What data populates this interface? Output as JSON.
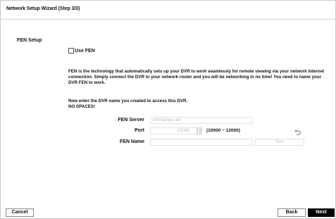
{
  "wizard": {
    "title": "Network Setup Wizard (Step 3/3)"
  },
  "fen_setup": {
    "section_label": "FEN Setup",
    "use_fen": {
      "label": "Use FEN",
      "checked": false
    },
    "description": "FEN is the technology that automatically sets up your DVR to work seamlessly for remote viewing via your network Internet connection. Simply connect the DVR to your network router and you will be networking in no time! You need to name your DVR FEN to work.",
    "instruction_line1": "Now enter the DVR name you created to access this DVR.",
    "instruction_line2": "NO SPACES!",
    "fen_server": {
      "label": "FEN Server",
      "value": "dvrnames.net"
    },
    "port": {
      "label": "Port",
      "value": "10088",
      "range": "(10000 ~ 12000)"
    },
    "fen_name": {
      "label": "FEN Name",
      "value": ""
    },
    "test_label": "Test"
  },
  "footer": {
    "cancel_label": "Cancel",
    "back_label": "Back",
    "next_label": "Next"
  },
  "icons": {
    "undo": "undo-arrow-icon",
    "spinner": "spinner-arrows-icon"
  },
  "colors": {
    "disabled_text": "#bdbdbd",
    "primary_button": "#000000"
  }
}
